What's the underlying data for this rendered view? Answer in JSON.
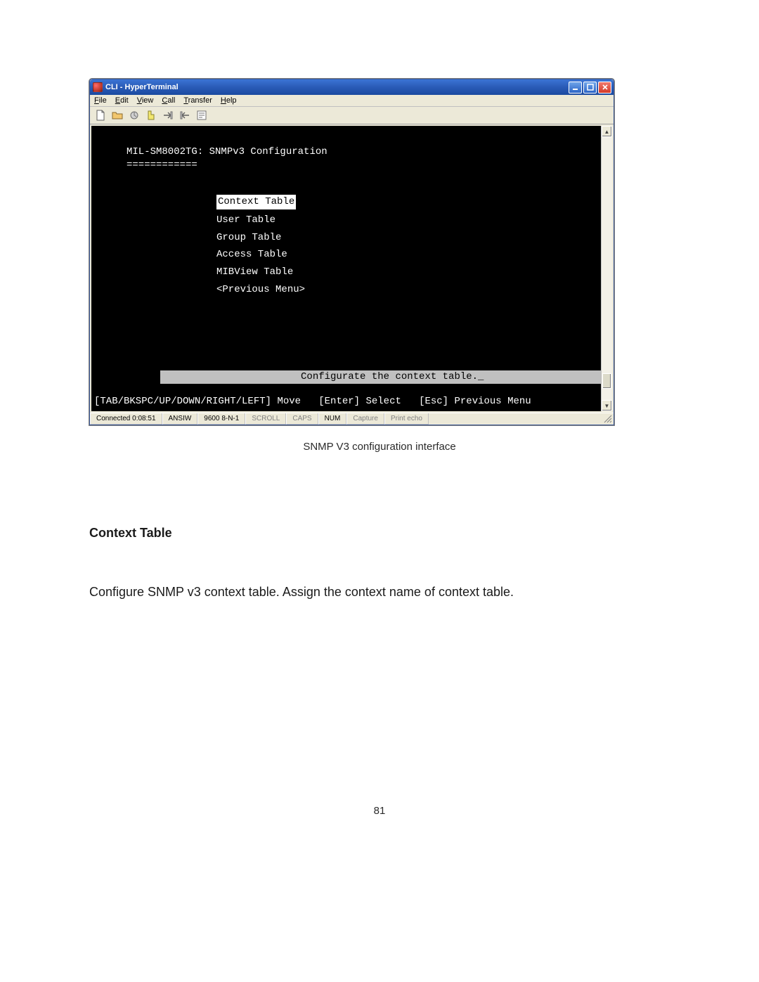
{
  "window": {
    "title": "CLI - HyperTerminal",
    "menubar": {
      "file": "File",
      "edit": "Edit",
      "view": "View",
      "call": "Call",
      "transfer": "Transfer",
      "help": "Help"
    }
  },
  "terminal": {
    "headerLine1": "MIL-SM8002TG: SNMPv3 Configuration",
    "headerLine2": "============",
    "menu": {
      "item0": "Context Table",
      "item1": "User Table",
      "item2": "Group Table",
      "item3": "Access Table",
      "item4": "MIBView Table",
      "item5": "<Previous Menu>"
    },
    "hint": "Configurate the context table._",
    "nav": "[TAB/BKSPC/UP/DOWN/RIGHT/LEFT] Move   [Enter] Select   [Esc] Previous Menu"
  },
  "statusbar": {
    "connected": "Connected 0:08:51",
    "emulation": "ANSIW",
    "port": "9600 8-N-1",
    "scroll": "SCROLL",
    "caps": "CAPS",
    "num": "NUM",
    "capture": "Capture",
    "printecho": "Print echo"
  },
  "doc": {
    "caption": "SNMP V3 configuration interface",
    "sectionTitle": "Context Table",
    "sectionBody": "Configure SNMP v3 context table. Assign the context name of context table.",
    "pageNumber": "81"
  }
}
